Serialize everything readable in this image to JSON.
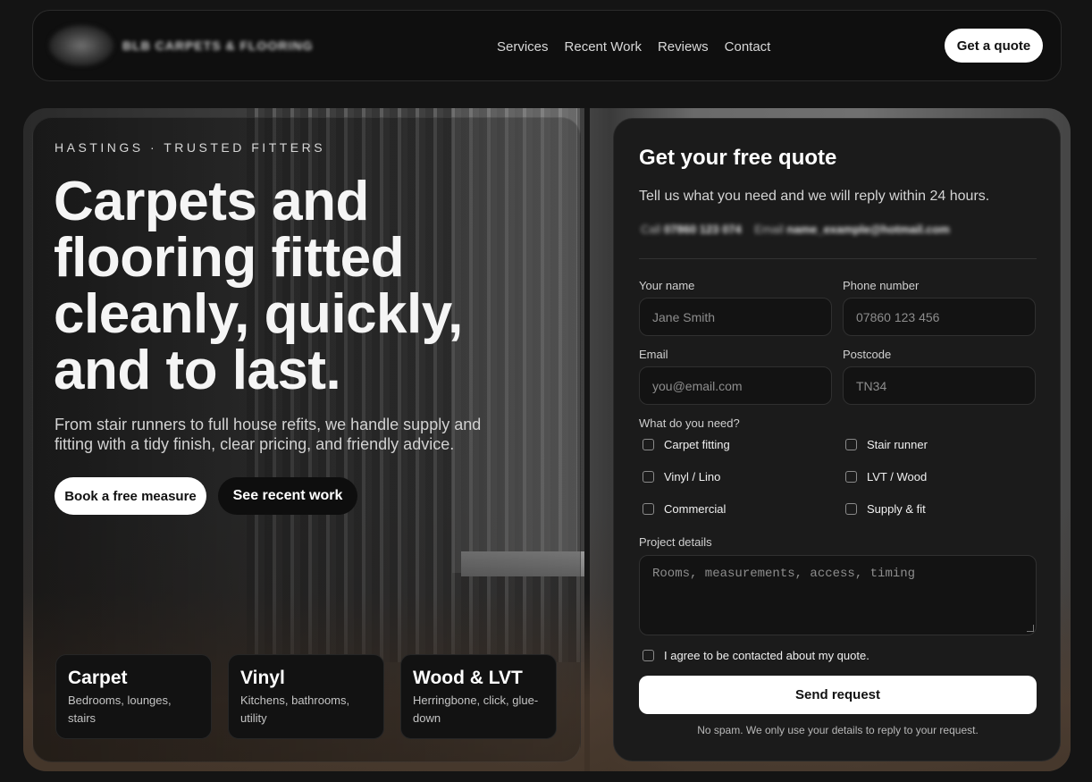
{
  "header": {
    "logo_text": "BLB CARPETS & FLOORING",
    "nav": [
      "Services",
      "Recent Work",
      "Reviews",
      "Contact"
    ],
    "cta": "Get a quote"
  },
  "hero": {
    "eyebrow": "HASTINGS · TRUSTED FITTERS",
    "headline": "Carpets and flooring fitted cleanly, quickly, and to last.",
    "subcopy": "From stair runners to full house refits, we handle supply and fitting with a tidy finish, clear pricing, and friendly advice.",
    "primary_button": "Book a free measure",
    "secondary_button": "See recent work",
    "cards": [
      {
        "title": "Carpet",
        "desc": "Bedrooms, lounges, stairs"
      },
      {
        "title": "Vinyl",
        "desc": "Kitchens, bathrooms, utility"
      },
      {
        "title": "Wood & LVT",
        "desc": "Herringbone, click, glue-down"
      }
    ]
  },
  "form": {
    "title": "Get your free quote",
    "subtitle": "Tell us what you need and we will reply within 24 hours.",
    "contact_call_label": "Call",
    "contact_phone": "07860 123 074",
    "contact_email_label": "Email",
    "contact_email": "name_example@hotmail.com",
    "name_label": "Your name",
    "name_placeholder": "Jane Smith",
    "phone_label": "Phone number",
    "phone_placeholder": "07860 123 456",
    "email_label": "Email",
    "email_placeholder": "you@email.com",
    "postcode_label": "Postcode",
    "postcode_placeholder": "TN34",
    "needs_label": "What do you need?",
    "options": [
      "Carpet fitting",
      "Stair runner",
      "Vinyl / Lino",
      "LVT / Wood",
      "Commercial",
      "Supply & fit"
    ],
    "details_label": "Project details",
    "details_placeholder": "Rooms, measurements, access, timing",
    "consent": "I agree to be contacted about my quote.",
    "submit": "Send request",
    "disclaimer": "No spam. We only use your details to reply to your request."
  }
}
